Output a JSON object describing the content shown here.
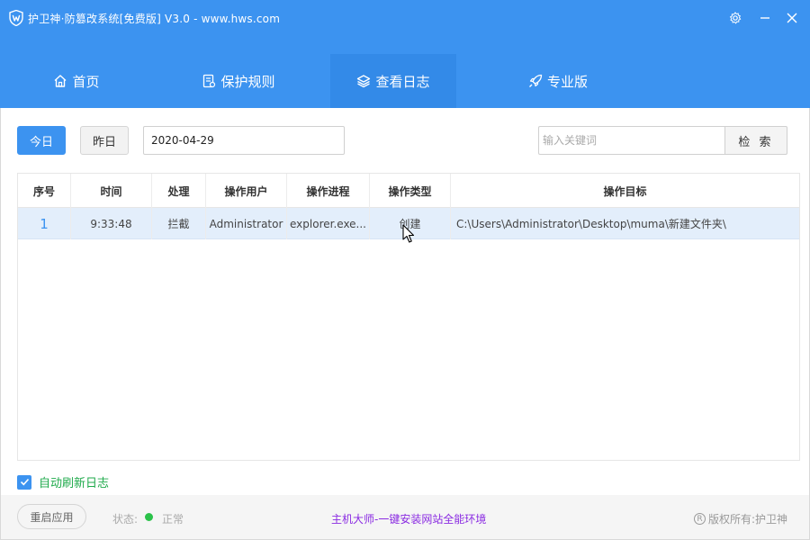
{
  "window": {
    "title": "护卫神·防篡改系统[免费版] V3.0 - www.hws.com"
  },
  "nav": {
    "tabs": [
      {
        "label": "首页",
        "icon": "home-icon",
        "active": false
      },
      {
        "label": "保护规则",
        "icon": "document-icon",
        "active": false
      },
      {
        "label": "查看日志",
        "icon": "layers-icon",
        "active": true
      },
      {
        "label": "专业版",
        "icon": "rocket-icon",
        "active": false
      }
    ]
  },
  "filters": {
    "today_label": "今日",
    "yesterday_label": "昨日",
    "date_value": "2020-04-29",
    "search_placeholder": "输入关键词",
    "search_button": "检 索"
  },
  "table": {
    "columns": [
      "序号",
      "时间",
      "处理",
      "操作用户",
      "操作进程",
      "操作类型",
      "操作目标"
    ],
    "rows": [
      {
        "index": "1",
        "time": "9:33:48",
        "action": "拦截",
        "user": "Administrator",
        "process": "explorer.exe...",
        "type": "创建",
        "target": "C:\\Users\\Administrator\\Desktop\\muma\\新建文件夹\\"
      }
    ]
  },
  "auto_refresh": {
    "label": "自动刷新日志",
    "checked": true
  },
  "footer": {
    "restart_button": "重启应用",
    "status_label": "状态:",
    "status_value": "正常",
    "status_color": "#2bc24a",
    "promo_link": "主机大师-一键安装网站全能环境",
    "copyright": "版权所有:护卫神"
  },
  "colors": {
    "accent": "#3c93f0",
    "selected_row": "#e3eefb",
    "promo": "#8a2be2",
    "auto_refresh_label": "#1faa4b"
  }
}
